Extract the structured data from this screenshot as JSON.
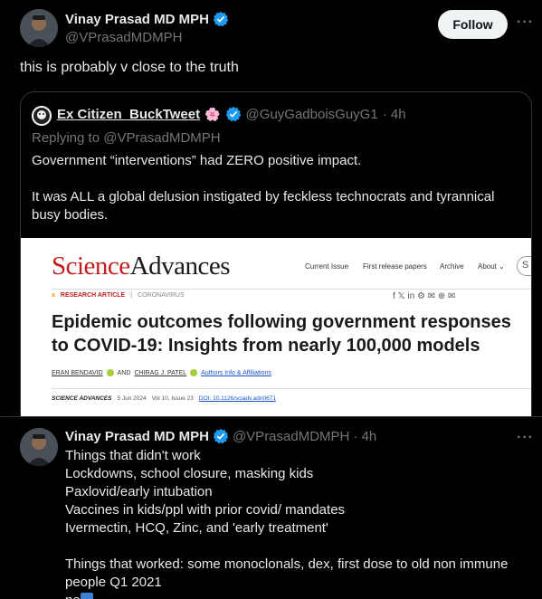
{
  "main_post": {
    "display_name": "Vinay Prasad MD MPH",
    "handle": "@VPrasadMDMPH",
    "follow_label": "Follow",
    "more_label": "···",
    "text": "this is probably v close to the truth"
  },
  "quoted_post": {
    "display_name": "Ex Citizen_BuckTweet",
    "badge_emoji": "🌸",
    "handle": "@GuyGadboisGuyG1",
    "time": "· 4h",
    "replying_to": "Replying to @VPrasadMDMPH",
    "text_lines": [
      "Government “interventions” had ZERO positive impact.",
      "It was ALL a global delusion instigated by feckless technocrats and tyrannical busy bodies."
    ],
    "article": {
      "logo_science": "Science",
      "logo_advances": "Advances",
      "nav": [
        "Current Issue",
        "First release papers",
        "Archive",
        "About ⌄"
      ],
      "search_icon": "search-icon",
      "section_label": "RESEARCH ARTICLE",
      "section_topic": "CORONAVIRUS",
      "share_icons": "f  𝕏  in  ⚙  ✉  ⊕  ✉",
      "title": "Epidemic outcomes following government responses to COVID-19: Insights from nearly 100,000 models",
      "author1": "ERAN BENDAVID",
      "and_label": "AND",
      "author2": "CHIRAG J. PATEL",
      "authors_link": "Authors Info & Affiliations",
      "journal": "SCIENCE ADVANCES",
      "date": "5 Jun 2024",
      "volume": "Vol 10, Issue 23",
      "doi": "DOI: 10.1126/sciadv.adn0671"
    }
  },
  "reply_post": {
    "display_name": "Vinay Prasad MD MPH",
    "handle": "@VPrasadMDMPH",
    "time": "· 4h",
    "more_label": "···",
    "lines": [
      "Things that didn't work",
      "Lockdowns, school closure, masking kids",
      "Paxlovid/early intubation",
      "Vaccines in kids/ppl with prior covid/ mandates",
      "Ivermectin, HCQ, Zinc, and 'early treatment'",
      "",
      "Things that worked:  some monoclonals, dex, first dose to old non immune",
      "people Q1 2021",
      "no"
    ]
  },
  "colors": {
    "background": "#000000",
    "text": "#e7e9ea",
    "muted": "#71767b",
    "verified": "#1d9bf0",
    "border": "#2f3336",
    "science_red": "#c41e1e"
  }
}
